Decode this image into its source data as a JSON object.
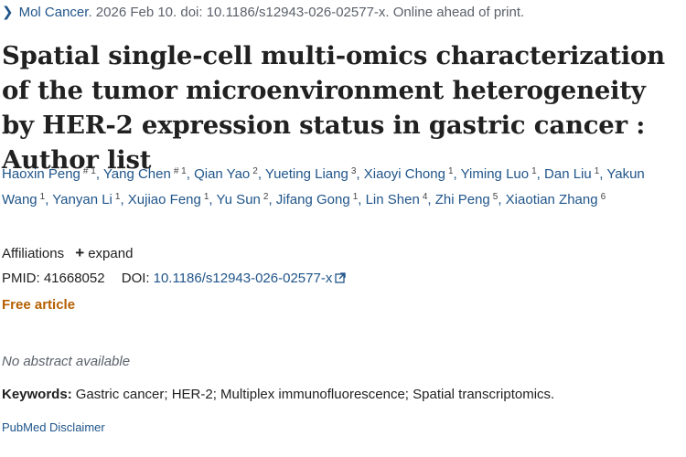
{
  "citation": {
    "journal": "Mol Cancer",
    "details": ". 2026 Feb 10. doi: 10.1186/s12943-026-02577-x. Online ahead of print."
  },
  "title": "Spatial single-cell multi-omics characterization of the tumor microenvironment heterogeneity by HER-2 expression status in gastric cancer : Author list",
  "authors": [
    {
      "name": "Haoxin Peng",
      "sup": "# 1"
    },
    {
      "name": "Yang Chen",
      "sup": "# 1"
    },
    {
      "name": "Qian Yao",
      "sup": "2"
    },
    {
      "name": "Yueting Liang",
      "sup": "3"
    },
    {
      "name": "Xiaoyi Chong",
      "sup": "1"
    },
    {
      "name": "Yiming Luo",
      "sup": "1"
    },
    {
      "name": "Dan Liu",
      "sup": "1"
    },
    {
      "name": "Yakun Wang",
      "sup": "1"
    },
    {
      "name": "Yanyan Li",
      "sup": "1"
    },
    {
      "name": "Xujiao Feng",
      "sup": "1"
    },
    {
      "name": "Yu Sun",
      "sup": "2"
    },
    {
      "name": "Jifang Gong",
      "sup": "1"
    },
    {
      "name": "Lin Shen",
      "sup": "4"
    },
    {
      "name": "Zhi Peng",
      "sup": "5"
    },
    {
      "name": "Xiaotian Zhang",
      "sup": "6"
    }
  ],
  "affiliations": {
    "label": "Affiliations",
    "plus": "+",
    "expand": "expand"
  },
  "ids": {
    "pmid_label": "PMID:",
    "pmid": "41668052",
    "doi_label": "DOI:",
    "doi": "10.1186/s12943-026-02577-x"
  },
  "free_article": "Free article",
  "no_abstract": "No abstract available",
  "keywords": {
    "label": "Keywords:",
    "value": "Gastric cancer; HER-2; Multiplex immunofluorescence; Spatial transcriptomics."
  },
  "disclaimer": "PubMed Disclaimer",
  "icons": {
    "citation_toggle": "chevron-right-icon",
    "external_link": "external-link-icon"
  },
  "colors": {
    "link": "#20558a",
    "free_article": "#b55f00",
    "muted": "#5b616b",
    "text": "#212121"
  }
}
